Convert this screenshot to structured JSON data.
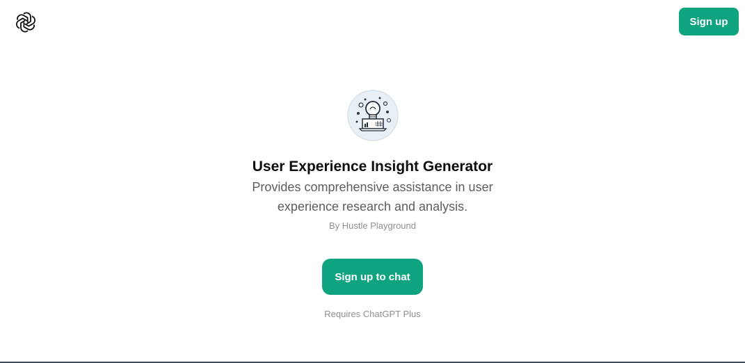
{
  "header": {
    "logo_icon": "openai-logo-icon",
    "signup_label": "Sign up"
  },
  "gpt": {
    "avatar_icon": "lightbulb-laptop-icon",
    "title": "User Experience Insight Generator",
    "description": "Provides comprehensive assistance in user experience research and analysis.",
    "author": "By Hustle Playground"
  },
  "cta": {
    "label": "Sign up to chat",
    "requirement": "Requires ChatGPT Plus"
  },
  "colors": {
    "accent": "#10a37f",
    "text_primary": "#0d0d0d",
    "text_secondary": "#5d5d5d",
    "text_muted": "#8e8e8e"
  }
}
